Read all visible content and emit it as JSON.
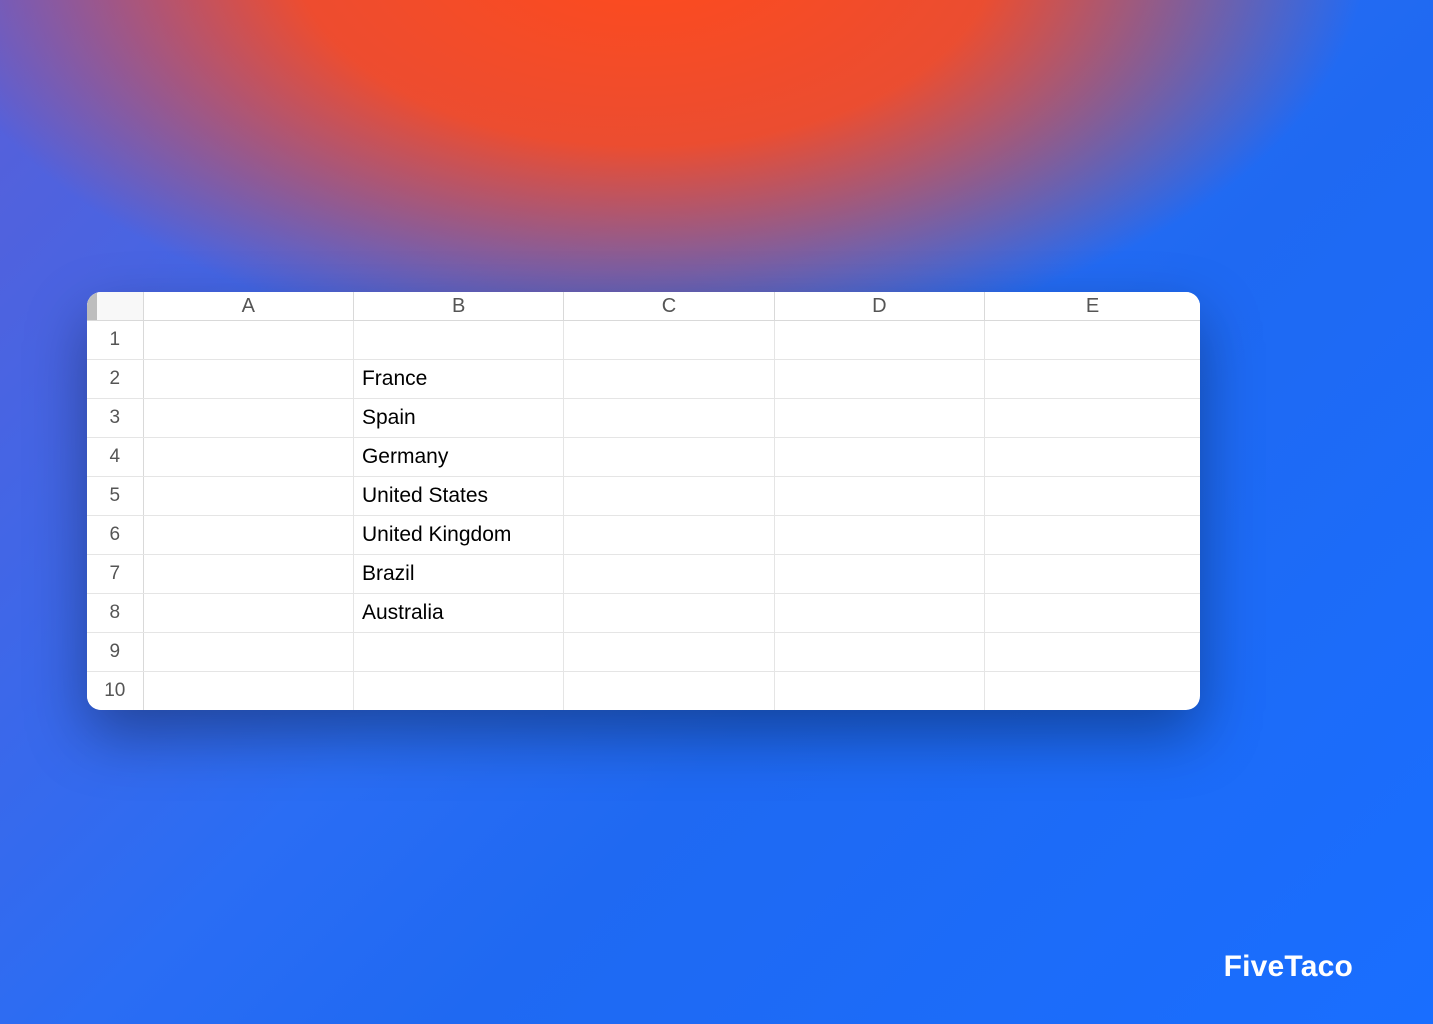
{
  "spreadsheet": {
    "columns": [
      "A",
      "B",
      "C",
      "D",
      "E"
    ],
    "row_numbers": [
      1,
      2,
      3,
      4,
      5,
      6,
      7,
      8,
      9,
      10
    ],
    "cells": {
      "B2": "France",
      "B3": "Spain",
      "B4": "Germany",
      "B5": "United States",
      "B6": "United Kingdom",
      "B7": "Brazil",
      "B8": "Australia"
    }
  },
  "brand": "FiveTaco"
}
